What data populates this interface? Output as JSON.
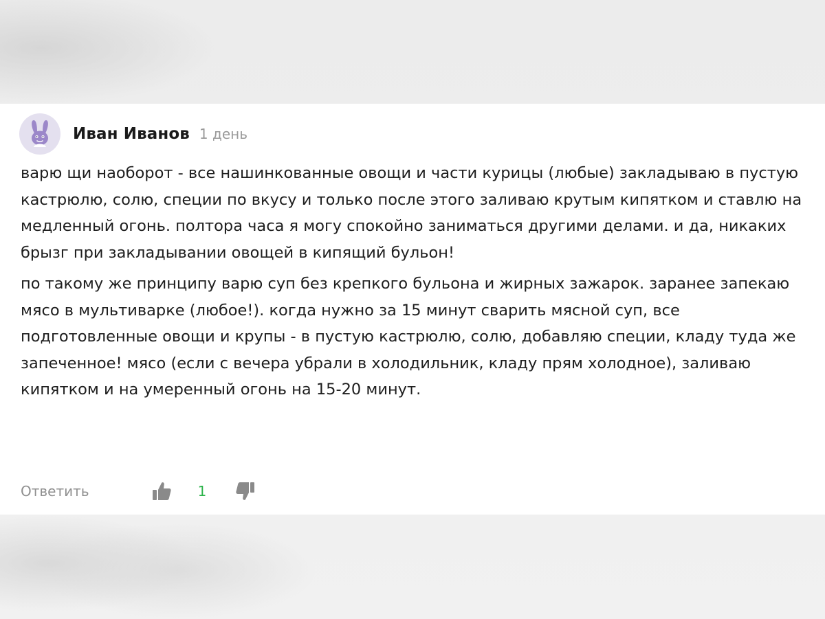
{
  "comment": {
    "author": "Иван Иванов",
    "time": "1 день",
    "avatar_icon": "bunny-avatar-icon",
    "avatar_color": "#9b87c9",
    "paragraphs": [
      "варю щи наоборот - все нашинкованные овощи и части курицы (любые) закладываю в пустую кастрюлю, солю, специи по вкусу и только после этого заливаю крутым кипятком и ставлю на медленный огонь. полтора часа я могу спокойно заниматься другими делами. и да, никаких брызг при закладывании овощей в кипящий бульон!",
      "по такому же принципу варю суп без крепкого бульона и жирных зажарок. заранее запекаю мясо в мультиварке (любое!). когда нужно за 15 минут сварить мясной суп, все подготовленные овощи и крупы - в пустую кастрюлю, солю, добавляю специи, кладу туда же запеченное! мясо (если с вечера убрали в холодильник, кладу прям холодное), заливаю кипятком и на умеренный огонь на 15-20 минут."
    ]
  },
  "actions": {
    "reply_label": "Ответить",
    "like_icon": "thumbs-up-icon",
    "likes": "1",
    "dislike_icon": "thumbs-down-icon",
    "like_count_color": "#2cb34a",
    "icon_color": "#8a8a8a"
  }
}
